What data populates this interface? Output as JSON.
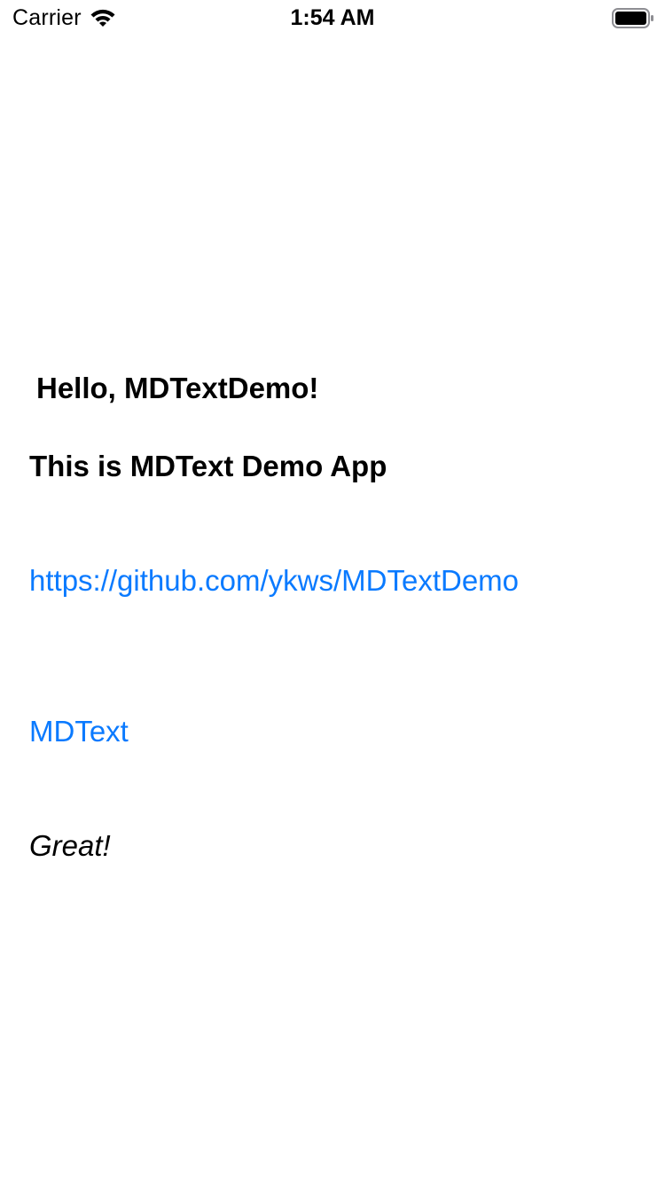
{
  "status_bar": {
    "carrier": "Carrier",
    "time": "1:54 AM",
    "icons": [
      "wifi-icon",
      "battery-icon"
    ]
  },
  "content": {
    "heading1": "Hello, MDTextDemo!",
    "heading2": "This is MDText Demo App",
    "link_url": "https://github.com/ykws/MDTextDemo",
    "link_text": "MDText",
    "italic_text": "Great!"
  },
  "colors": {
    "background": "#ffffff",
    "text": "#000000",
    "link": "#0a7aff"
  }
}
